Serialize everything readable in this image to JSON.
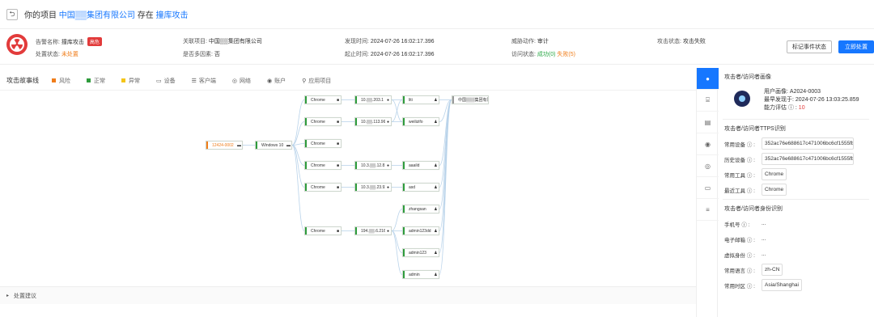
{
  "header": {
    "back_icon": "undo-icon",
    "prefix": "你的项目",
    "project": "中国▒▒集团有限公司",
    "mid": "存在",
    "event": "撞库攻击"
  },
  "info": {
    "alarm_name_label": "告警名称:",
    "alarm_name": "撞库攻击",
    "severity": "高危",
    "status_label": "处置状态:",
    "status": "未处置",
    "project_label": "关联项目:",
    "project": "中国▒▒集团有限公司",
    "false_positive_label": "是否多因素:",
    "false_positive": "否",
    "found_label": "发现时间:",
    "found": "2024-07-26 16:02:17.396",
    "start_label": "起止时间:",
    "start": "2024-07-26 16:02:17.396",
    "action_label": "威胁动作:",
    "action": "审计",
    "access_label": "访问状态:",
    "access_success": "成功(0)",
    "access_fail": "失败(5)",
    "result_label": "攻击状态:",
    "result": "攻击失败",
    "mark_button": "标记事件状态",
    "handle_button": "立即处置"
  },
  "legend": {
    "title": "攻击故事线",
    "items": [
      {
        "label": "风险",
        "color": "#f07d1a"
      },
      {
        "label": "正常",
        "color": "#2e9b3c"
      },
      {
        "label": "异常",
        "color": "#f5c518"
      }
    ],
    "icons": [
      {
        "label": "设备",
        "icon": "device-icon",
        "glyph": "▭"
      },
      {
        "label": "客户端",
        "icon": "client-icon",
        "glyph": "☰"
      },
      {
        "label": "网络",
        "icon": "network-icon",
        "glyph": "◎"
      },
      {
        "label": "账户",
        "icon": "account-icon",
        "glyph": "◉"
      },
      {
        "label": "应用项目",
        "icon": "app-icon",
        "glyph": "⚲"
      }
    ]
  },
  "graph": {
    "nodes": [
      {
        "id": "src",
        "label": "12424-0002",
        "type": "orange"
      },
      {
        "id": "win",
        "label": "Windows 10",
        "type": "green"
      },
      {
        "id": "c1",
        "label": "Chrome",
        "type": "green"
      },
      {
        "id": "c2",
        "label": "Chrome",
        "type": "green"
      },
      {
        "id": "c3",
        "label": "Chrome",
        "type": "green"
      },
      {
        "id": "c4",
        "label": "Chrome",
        "type": "green"
      },
      {
        "id": "c5",
        "label": "Chrome",
        "type": "green"
      },
      {
        "id": "c6",
        "label": "Chrome",
        "type": "green"
      },
      {
        "id": "ip1",
        "label": "10.▒▒.203.1",
        "type": "green"
      },
      {
        "id": "ip2",
        "label": "10.▒▒.113.96",
        "type": "green"
      },
      {
        "id": "ip3",
        "label": "10.3.▒▒.12.81",
        "type": "green"
      },
      {
        "id": "ip4",
        "label": "10.3.▒▒.23.93",
        "type": "green"
      },
      {
        "id": "ip5",
        "label": "194.▒▒.6.216",
        "type": "green"
      },
      {
        "id": "a1",
        "label": "liti",
        "type": "green"
      },
      {
        "id": "a2",
        "label": "weilizifo",
        "type": "green"
      },
      {
        "id": "a3",
        "label": "aaaild",
        "type": "green"
      },
      {
        "id": "a4",
        "label": "asd",
        "type": "green"
      },
      {
        "id": "a5",
        "label": "zhangsan",
        "type": "green"
      },
      {
        "id": "a6",
        "label": "admin123dd",
        "type": "green"
      },
      {
        "id": "a7",
        "label": "admin123",
        "type": "green"
      },
      {
        "id": "a8",
        "label": "admin",
        "type": "green"
      },
      {
        "id": "t",
        "label": "中国▒▒▒集团有限公司",
        "type": "gray"
      }
    ]
  },
  "bottom": {
    "label": "处置建议"
  },
  "side_icons": [
    "user-icon",
    "profile-icon",
    "log-icon",
    "account-icon",
    "network-icon",
    "device-icon",
    "list-icon"
  ],
  "panel": {
    "title": "攻击者/访问者画像",
    "portrait_label": "用户画像:",
    "portrait": "A2024-0003",
    "first_seen_label": "最早发现于:",
    "first_seen": "2024-07-26 13:03:25.859",
    "ability_label": "能力评估",
    "ability": "10",
    "ttps_title": "攻击者/访问者TTPS识别",
    "ttps": [
      {
        "label": "常用设备",
        "value": "352ac76e688617c471006bc6cf1555fb",
        "info": true
      },
      {
        "label": "历史设备",
        "value": "352ac76e688617c471006bc6cf1555fb",
        "info": true
      },
      {
        "label": "常用工具",
        "value": "Chrome",
        "info": true
      },
      {
        "label": "最近工具",
        "value": "Chrome",
        "info": true
      }
    ],
    "identity_title": "攻击者/访问者身份识别",
    "identity": [
      {
        "label": "手机号",
        "value": "...",
        "tag": false
      },
      {
        "label": "电子邮箱",
        "value": "...",
        "tag": false
      },
      {
        "label": "虚拟身份",
        "value": "...",
        "tag": false
      },
      {
        "label": "常用语言",
        "value": "zh-CN",
        "tag": true
      },
      {
        "label": "常用时区",
        "value": "Asia/Shanghai",
        "tag": true
      }
    ]
  },
  "colors": {
    "accent": "#1677ff",
    "danger": "#e23b3b",
    "risk": "#f07d1a",
    "normal": "#2e9b3c"
  }
}
